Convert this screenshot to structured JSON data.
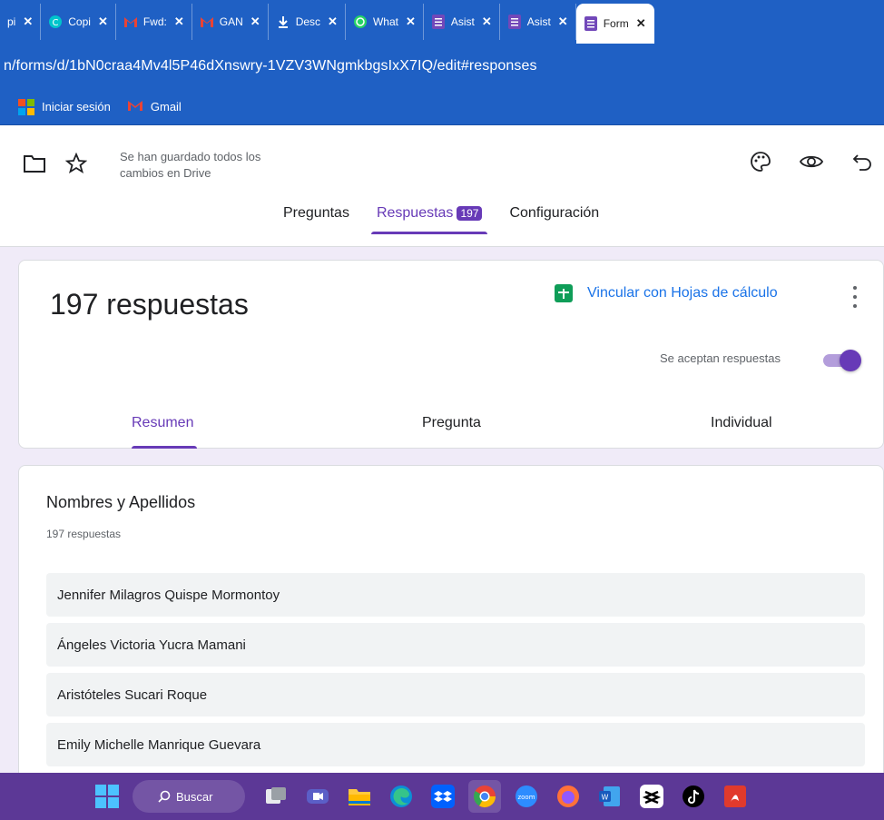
{
  "browser": {
    "tabs": [
      {
        "label": "pi",
        "icon": "doc-icon",
        "color": "#ffffff"
      },
      {
        "label": "Copi",
        "icon": "canva-icon",
        "color": "#00c4cc"
      },
      {
        "label": "Fwd:",
        "icon": "gmail-icon",
        "color": "#ea4335"
      },
      {
        "label": "GAN",
        "icon": "gmail-icon",
        "color": "#ea4335"
      },
      {
        "label": "Desc",
        "icon": "download-icon",
        "color": "#ffffff"
      },
      {
        "label": "What",
        "icon": "whatsapp-icon",
        "color": "#25d366"
      },
      {
        "label": "Asist",
        "icon": "forms-icon",
        "color": "#7248b9"
      },
      {
        "label": "Asist",
        "icon": "forms-icon",
        "color": "#7248b9"
      },
      {
        "label": "Form",
        "icon": "forms-icon",
        "color": "#7248b9"
      }
    ],
    "url": "n/forms/d/1bN0craa4Mv4l5P46dXnswry-1VZV3WNgmkbgsIxX7IQ/edit#responses",
    "bookmarks": [
      {
        "label": "Iniciar sesión",
        "icon": "microsoft-icon"
      },
      {
        "label": "Gmail",
        "icon": "gmail-icon"
      }
    ]
  },
  "header": {
    "saved_status": "Se han guardado todos los cambios en Drive",
    "tabs": {
      "questions": "Preguntas",
      "responses": "Respuestas",
      "responses_count": "197",
      "settings": "Configuración"
    }
  },
  "summary": {
    "title": "197 respuestas",
    "link_sheets": "Vincular con Hojas de cálculo",
    "accepting_label": "Se aceptan respuestas",
    "accepting": true,
    "subtabs": {
      "summary": "Resumen",
      "question": "Pregunta",
      "individual": "Individual"
    }
  },
  "question": {
    "title": "Nombres y Apellidos",
    "count": "197 respuestas",
    "answers": [
      "Jennifer Milagros Quispe Mormontoy",
      "Ángeles Victoria Yucra Mamani",
      "Aristóteles Sucari Roque",
      "Emily Michelle Manrique Guevara"
    ]
  },
  "taskbar": {
    "search_label": "Buscar",
    "apps": [
      "start-icon",
      "task-view-icon",
      "meet-icon",
      "file-explorer-icon",
      "edge-icon",
      "dropbox-icon",
      "chrome-icon",
      "zoom-icon",
      "firefox-icon",
      "word-icon",
      "capcut-icon",
      "tiktok-icon",
      "acrobat-icon"
    ]
  },
  "colors": {
    "accent": "#673ab7",
    "browser_blue": "#1f60c4",
    "taskbar": "#5c3896",
    "link": "#1a73e8"
  }
}
